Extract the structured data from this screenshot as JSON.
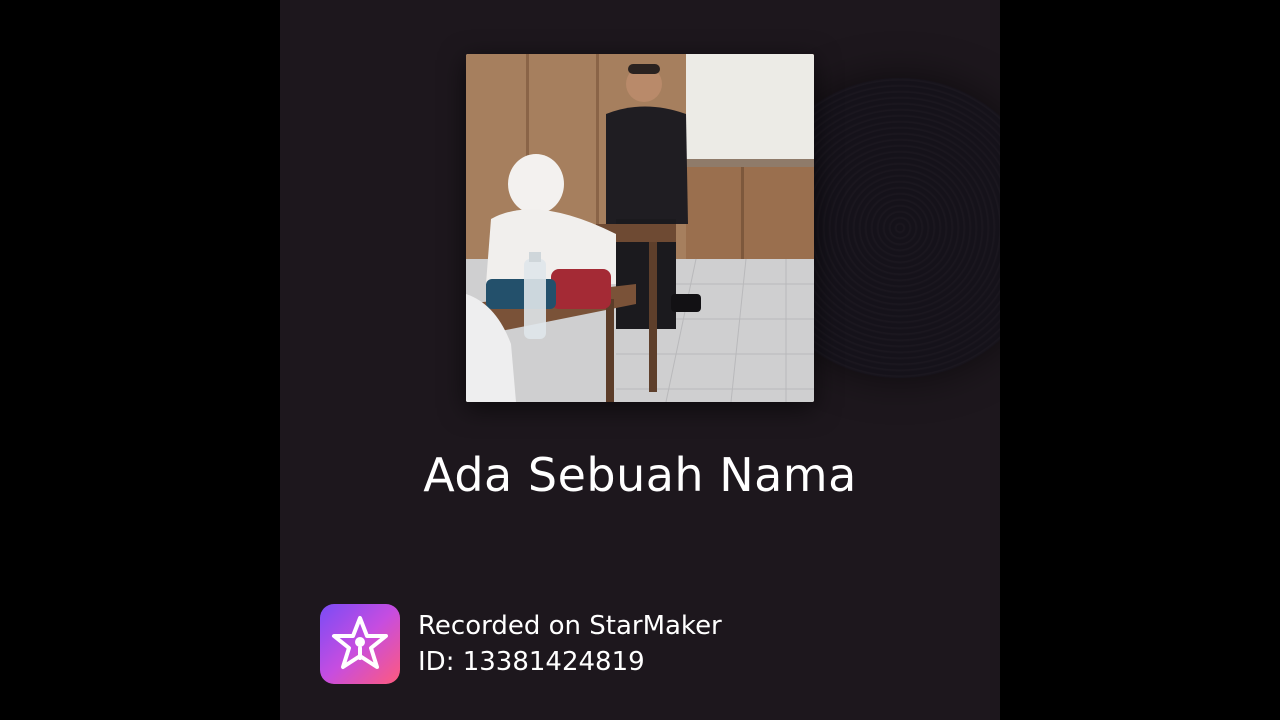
{
  "song": {
    "title": "Ada Sebuah Nama"
  },
  "cover": {
    "icon": "album-cover-image"
  },
  "watermark": {
    "recorded_label": "Recorded on StarMaker",
    "id_text": "ID: 13381424819",
    "logo_icon": "starmaker-star-mic-icon"
  },
  "colors": {
    "background": "#000000",
    "player_background": "#1d171d",
    "text": "#ffffff",
    "logo_gradient_start": "#7a4cf6",
    "logo_gradient_end": "#ff5a7d"
  }
}
